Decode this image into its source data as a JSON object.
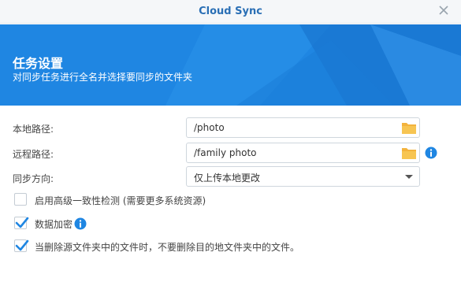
{
  "window": {
    "title": "Cloud Sync"
  },
  "banner": {
    "heading": "任务设置",
    "subtitle": "对同步任务进行全名并选择要同步的文件夹"
  },
  "form": {
    "local_path": {
      "label": "本地路径:",
      "value": "/photo"
    },
    "remote_path": {
      "label": "远程路径:",
      "value": "/family photo"
    },
    "sync_direction": {
      "label": "同步方向:",
      "value": "仅上传本地更改"
    },
    "options": [
      {
        "label": "启用高级一致性检测 (需要更多系统资源)",
        "checked": false
      },
      {
        "label": "数据加密",
        "checked": true
      },
      {
        "label": "当删除源文件夹中的文件时，不要删除目的地文件夹中的文件。",
        "checked": true
      }
    ]
  },
  "icons": {
    "close": "close-icon",
    "folder": "folder-icon",
    "info": "info-icon",
    "dropdown": "chevron-down-icon",
    "check": "checkmark-icon"
  },
  "colors": {
    "accent": "#1f86e2",
    "title": "#2a6fb5",
    "folder": "#f3b33d",
    "check": "#1f86e2"
  }
}
